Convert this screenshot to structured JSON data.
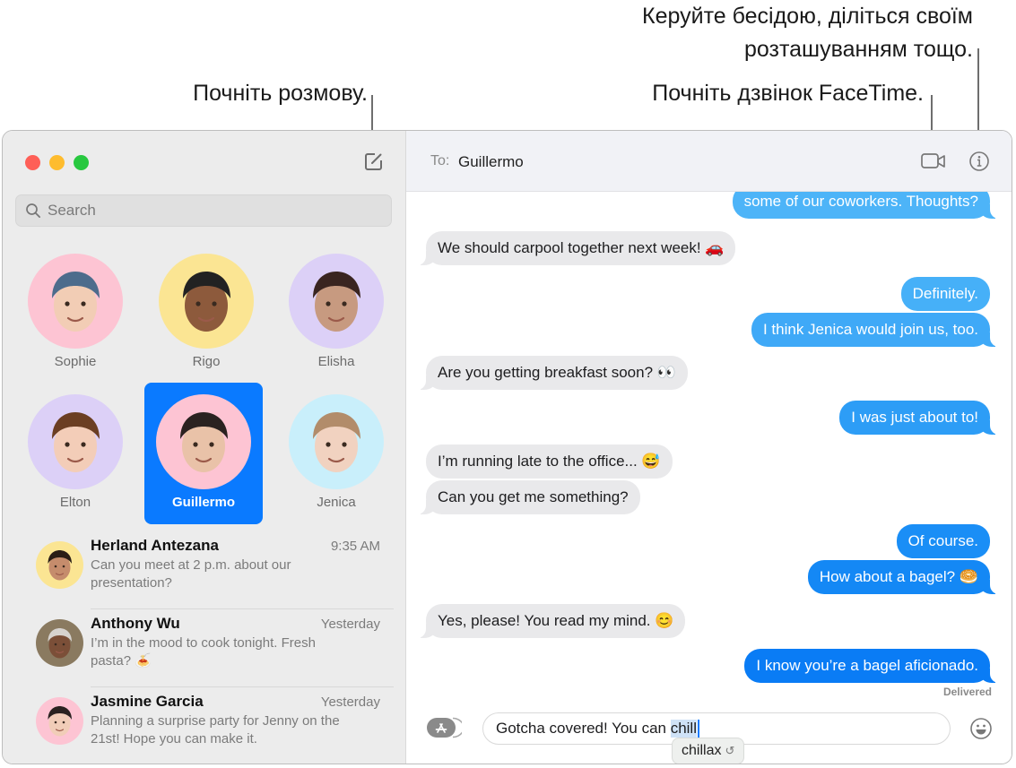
{
  "callouts": {
    "manage": [
      "Керуйте бесідою, діліться своїм",
      "розташуванням тощо."
    ],
    "facetime": "Почніть дзвінок FaceTime.",
    "compose": "Почніть розмову."
  },
  "sidebar": {
    "search_placeholder": "Search",
    "pinned": [
      {
        "name": "Sophie",
        "bg": "#fdc4d3"
      },
      {
        "name": "Rigo",
        "bg": "#fbe593"
      },
      {
        "name": "Elisha",
        "bg": "#dcd0f7"
      },
      {
        "name": "Elton",
        "bg": "#dcd0f7"
      },
      {
        "name": "Guillermo",
        "bg": "#fdc4d3",
        "selected": true
      },
      {
        "name": "Jenica",
        "bg": "#c9effb"
      }
    ],
    "conversations": [
      {
        "name": "Herland Antezana",
        "time": "9:35 AM",
        "preview": "Can you meet at 2 p.m. about our presentation?",
        "avatar_bg": "#fbe593"
      },
      {
        "name": "Anthony Wu",
        "time": "Yesterday",
        "preview": "I’m in the mood to cook tonight. Fresh pasta? 🍝",
        "avatar_bg": "#8a7a60"
      },
      {
        "name": "Jasmine Garcia",
        "time": "Yesterday",
        "preview": "Planning a surprise party for Jenny on the 21st! Hope you can make it.",
        "avatar_bg": "#fdc4d3"
      }
    ]
  },
  "chat": {
    "to_label": "To:",
    "recipient": "Guillermo",
    "messages": [
      {
        "dir": "out",
        "text": "some of our coworkers. Thoughts?",
        "color": "#4db4f8"
      },
      {
        "dir": "in",
        "text": "We should carpool together next week! 🚗"
      },
      {
        "dir": "out",
        "text": "Definitely.",
        "color": "#46b0f8"
      },
      {
        "dir": "out",
        "text": "I think Jenica would join us, too.",
        "color": "#3fa9f7"
      },
      {
        "dir": "in",
        "text": "Are you getting breakfast soon? 👀"
      },
      {
        "dir": "out",
        "text": "I was just about to!",
        "color": "#2d9df6"
      },
      {
        "dir": "in",
        "text": "I’m running late to the office... 😅"
      },
      {
        "dir": "in",
        "text": "Can you get me something?"
      },
      {
        "dir": "out",
        "text": "Of course.",
        "color": "#1a8ef6"
      },
      {
        "dir": "out",
        "text": "How about a bagel? 🥯",
        "color": "#1488f5"
      },
      {
        "dir": "in",
        "text": "Yes, please! You read my mind. 😊"
      },
      {
        "dir": "out",
        "text": "I know you’re a bagel aficionado.",
        "color": "#0a7cf5"
      }
    ],
    "status": "Delivered",
    "input_text": "Gotcha covered! You can ",
    "input_selected": "chill",
    "suggestion": "chillax",
    "suggestion_icon": "↺"
  },
  "colors": {
    "accent": "#0a7aff",
    "incoming_bubble": "#e9e9eb",
    "sidebar_bg": "#ececec"
  }
}
